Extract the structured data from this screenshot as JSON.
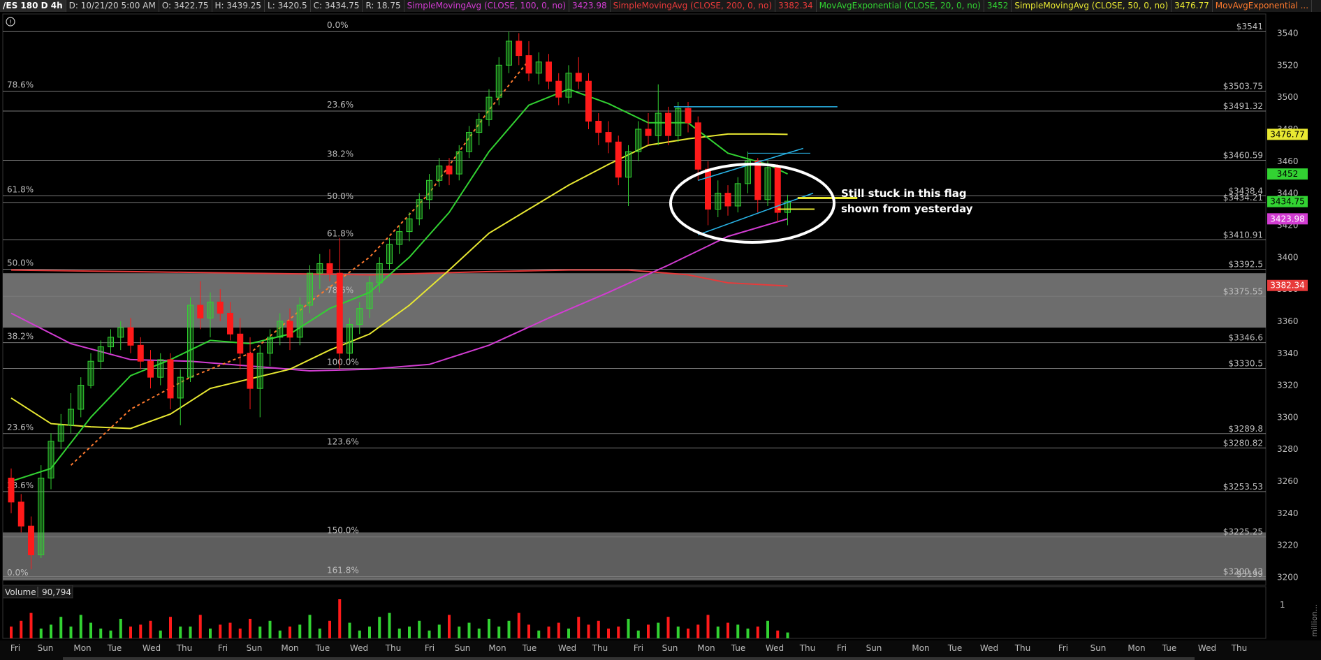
{
  "header": {
    "symbol": "/ES 180 D 4h",
    "date": "D: 10/21/20 5:00 AM",
    "open": "O: 3422.75",
    "high": "H: 3439.25",
    "low": "L: 3420.5",
    "close": "C: 3434.75",
    "range": "R: 18.75",
    "studies": [
      {
        "label": "SimpleMovingAvg (CLOSE, 100, 0, no)",
        "value": "3423.98",
        "color": "#d23cd2"
      },
      {
        "label": "SimpleMovingAvg (CLOSE, 200, 0, no)",
        "value": "3382.34",
        "color": "#e83a3a"
      },
      {
        "label": "MovAvgExponential (CLOSE, 20, 0, no)",
        "value": "3452",
        "color": "#32d232"
      },
      {
        "label": "SimpleMovingAvg (CLOSE, 50, 0, no)",
        "value": "3476.77",
        "color": "#e8e832"
      },
      {
        "label": "MovAvgExponential ...",
        "value": "",
        "color": "#ff7a2e"
      }
    ]
  },
  "annotation": {
    "line1": "Still stuck in this flag",
    "line2": "shown from yesterday"
  },
  "volume": {
    "label": "Volume",
    "value": "90,794",
    "scale_label": "1",
    "unit_label": "million..."
  },
  "chart_data": {
    "type": "candlestick",
    "symbol": "/ES",
    "timeframe": "4h",
    "ylim": [
      3195,
      3552
    ],
    "y_ticks": [
      3200,
      3220,
      3240,
      3260,
      3280,
      3300,
      3320,
      3340,
      3360,
      3380,
      3400,
      3420,
      3440,
      3460,
      3480,
      3500,
      3520,
      3540
    ],
    "x_labels": [
      "Fri",
      "Sun",
      "Mon",
      "Tue",
      "Wed",
      "Thu",
      "Fri",
      "Sun",
      "Mon",
      "Tue",
      "Wed",
      "Thu",
      "Fri",
      "Sun",
      "Mon",
      "Tue",
      "Wed",
      "Thu",
      "Fri",
      "Sun",
      "Mon",
      "Tue",
      "Wed",
      "Thu",
      "Fri",
      "Sun",
      "Mon",
      "Tue",
      "Wed",
      "Thu",
      "Fri",
      "Sun",
      "Mon",
      "Tue",
      "Wed",
      "Thu"
    ],
    "price_levels": [
      {
        "value": 3541,
        "label": "$3541"
      },
      {
        "value": 3503.75,
        "label": "$3503.75"
      },
      {
        "value": 3491.32,
        "label": "$3491.32"
      },
      {
        "value": 3460.59,
        "label": "$3460.59"
      },
      {
        "value": 3438.4,
        "label": "$3438.4"
      },
      {
        "value": 3434.21,
        "label": "$3434.21"
      },
      {
        "value": 3410.91,
        "label": "$3410.91"
      },
      {
        "value": 3392.5,
        "label": "$3392.5"
      },
      {
        "value": 3375.55,
        "label": "$3375.55"
      },
      {
        "value": 3346.6,
        "label": "$3346.6"
      },
      {
        "value": 3330.5,
        "label": "$3330.5"
      },
      {
        "value": 3289.8,
        "label": "$3289.8"
      },
      {
        "value": 3280.82,
        "label": "$3280.82"
      },
      {
        "value": 3253.53,
        "label": "$3253.53"
      },
      {
        "value": 3225.25,
        "label": "$3225.25"
      },
      {
        "value": 3200.43,
        "label": "$3200.43"
      },
      {
        "value": 3199,
        "label": "$3199"
      }
    ],
    "fib_set_left": [
      {
        "label": "78.6%",
        "value": 3503.75
      },
      {
        "label": "61.8%",
        "value": 3438.4
      },
      {
        "label": "50.0%",
        "value": 3392.5
      },
      {
        "label": "38.2%",
        "value": 3346.6
      },
      {
        "label": "23.6%",
        "value": 3289.8
      },
      {
        "label": "23.6%",
        "value": 3253.53
      },
      {
        "label": "0.0%",
        "value": 3199
      }
    ],
    "fib_set_mid": [
      {
        "label": "0.0%",
        "value": 3541
      },
      {
        "label": "23.6%",
        "value": 3491.32
      },
      {
        "label": "38.2%",
        "value": 3460.59
      },
      {
        "label": "50.0%",
        "value": 3434.21
      },
      {
        "label": "61.8%",
        "value": 3410.91
      },
      {
        "label": "78.6%",
        "value": 3375.55
      },
      {
        "label": "100.0%",
        "value": 3330.5
      },
      {
        "label": "123.6%",
        "value": 3280.82
      },
      {
        "label": "150.0%",
        "value": 3225.25
      },
      {
        "label": "161.8%",
        "value": 3200.43
      }
    ],
    "zones": [
      {
        "from": 3356,
        "to": 3390,
        "color": "#808080"
      },
      {
        "from": 3198,
        "to": 3228,
        "color": "#6e6e6e"
      }
    ],
    "price_tags": [
      {
        "value": 3476.77,
        "label": "3476.77",
        "color": "#e8e832"
      },
      {
        "value": 3452,
        "label": "3452",
        "color": "#32d232"
      },
      {
        "value": 3434.75,
        "label": "3434.75",
        "color": "#32d232"
      },
      {
        "value": 3423.98,
        "label": "3423.98",
        "color": "#d23cd2"
      },
      {
        "value": 3382.34,
        "label": "3382.34",
        "color": "#e83a3a"
      }
    ],
    "colors": {
      "up": "#32d232",
      "down": "#ff1a1a",
      "ema20": "#32d232",
      "sma50": "#e8e832",
      "sma100": "#d23cd2",
      "sma200": "#e83a3a",
      "ema_other": "#ff7a2e",
      "channel": "#29b5e8"
    },
    "candles": [
      {
        "i": 0,
        "o": 3262,
        "h": 3268,
        "l": 3240,
        "c": 3247
      },
      {
        "i": 1,
        "o": 3247,
        "h": 3252,
        "l": 3228,
        "c": 3232
      },
      {
        "i": 2,
        "o": 3232,
        "h": 3238,
        "l": 3205,
        "c": 3214
      },
      {
        "i": 3,
        "o": 3214,
        "h": 3270,
        "l": 3212,
        "c": 3262
      },
      {
        "i": 4,
        "o": 3262,
        "h": 3290,
        "l": 3255,
        "c": 3285
      },
      {
        "i": 5,
        "o": 3285,
        "h": 3302,
        "l": 3280,
        "c": 3295
      },
      {
        "i": 6,
        "o": 3295,
        "h": 3315,
        "l": 3290,
        "c": 3305
      },
      {
        "i": 7,
        "o": 3305,
        "h": 3325,
        "l": 3300,
        "c": 3320
      },
      {
        "i": 8,
        "o": 3320,
        "h": 3340,
        "l": 3318,
        "c": 3335
      },
      {
        "i": 9,
        "o": 3335,
        "h": 3348,
        "l": 3330,
        "c": 3344
      },
      {
        "i": 10,
        "o": 3344,
        "h": 3355,
        "l": 3340,
        "c": 3350
      },
      {
        "i": 11,
        "o": 3350,
        "h": 3360,
        "l": 3342,
        "c": 3356
      },
      {
        "i": 12,
        "o": 3356,
        "h": 3362,
        "l": 3340,
        "c": 3345
      },
      {
        "i": 13,
        "o": 3345,
        "h": 3350,
        "l": 3330,
        "c": 3335
      },
      {
        "i": 14,
        "o": 3335,
        "h": 3342,
        "l": 3318,
        "c": 3325
      },
      {
        "i": 15,
        "o": 3325,
        "h": 3340,
        "l": 3320,
        "c": 3336
      },
      {
        "i": 16,
        "o": 3336,
        "h": 3340,
        "l": 3305,
        "c": 3312
      },
      {
        "i": 17,
        "o": 3312,
        "h": 3330,
        "l": 3295,
        "c": 3325
      },
      {
        "i": 18,
        "o": 3325,
        "h": 3375,
        "l": 3322,
        "c": 3370
      },
      {
        "i": 19,
        "o": 3370,
        "h": 3385,
        "l": 3355,
        "c": 3362
      },
      {
        "i": 20,
        "o": 3362,
        "h": 3378,
        "l": 3350,
        "c": 3372
      },
      {
        "i": 21,
        "o": 3372,
        "h": 3380,
        "l": 3360,
        "c": 3365
      },
      {
        "i": 22,
        "o": 3365,
        "h": 3372,
        "l": 3348,
        "c": 3352
      },
      {
        "i": 23,
        "o": 3352,
        "h": 3362,
        "l": 3330,
        "c": 3340
      },
      {
        "i": 24,
        "o": 3340,
        "h": 3350,
        "l": 3305,
        "c": 3318
      },
      {
        "i": 25,
        "o": 3318,
        "h": 3345,
        "l": 3300,
        "c": 3340
      },
      {
        "i": 26,
        "o": 3340,
        "h": 3355,
        "l": 3332,
        "c": 3350
      },
      {
        "i": 27,
        "o": 3350,
        "h": 3365,
        "l": 3345,
        "c": 3360
      },
      {
        "i": 28,
        "o": 3360,
        "h": 3368,
        "l": 3342,
        "c": 3350
      },
      {
        "i": 29,
        "o": 3350,
        "h": 3375,
        "l": 3345,
        "c": 3370
      },
      {
        "i": 30,
        "o": 3370,
        "h": 3395,
        "l": 3365,
        "c": 3390
      },
      {
        "i": 31,
        "o": 3390,
        "h": 3402,
        "l": 3380,
        "c": 3396
      },
      {
        "i": 32,
        "o": 3396,
        "h": 3405,
        "l": 3385,
        "c": 3390
      },
      {
        "i": 33,
        "o": 3390,
        "h": 3412,
        "l": 3330,
        "c": 3340
      },
      {
        "i": 34,
        "o": 3340,
        "h": 3362,
        "l": 3336,
        "c": 3358
      },
      {
        "i": 35,
        "o": 3358,
        "h": 3372,
        "l": 3352,
        "c": 3368
      },
      {
        "i": 36,
        "o": 3368,
        "h": 3388,
        "l": 3362,
        "c": 3384
      },
      {
        "i": 37,
        "o": 3384,
        "h": 3400,
        "l": 3378,
        "c": 3396
      },
      {
        "i": 38,
        "o": 3396,
        "h": 3412,
        "l": 3392,
        "c": 3408
      },
      {
        "i": 39,
        "o": 3408,
        "h": 3420,
        "l": 3402,
        "c": 3416
      },
      {
        "i": 40,
        "o": 3416,
        "h": 3428,
        "l": 3410,
        "c": 3424
      },
      {
        "i": 41,
        "o": 3424,
        "h": 3440,
        "l": 3420,
        "c": 3436
      },
      {
        "i": 42,
        "o": 3436,
        "h": 3452,
        "l": 3430,
        "c": 3448
      },
      {
        "i": 43,
        "o": 3448,
        "h": 3462,
        "l": 3444,
        "c": 3457
      },
      {
        "i": 44,
        "o": 3457,
        "h": 3462,
        "l": 3445,
        "c": 3452
      },
      {
        "i": 45,
        "o": 3452,
        "h": 3470,
        "l": 3448,
        "c": 3466
      },
      {
        "i": 46,
        "o": 3466,
        "h": 3482,
        "l": 3462,
        "c": 3478
      },
      {
        "i": 47,
        "o": 3478,
        "h": 3490,
        "l": 3470,
        "c": 3486
      },
      {
        "i": 48,
        "o": 3486,
        "h": 3505,
        "l": 3482,
        "c": 3500
      },
      {
        "i": 49,
        "o": 3500,
        "h": 3525,
        "l": 3495,
        "c": 3520
      },
      {
        "i": 50,
        "o": 3520,
        "h": 3541,
        "l": 3515,
        "c": 3535
      },
      {
        "i": 51,
        "o": 3535,
        "h": 3540,
        "l": 3520,
        "c": 3526
      },
      {
        "i": 52,
        "o": 3526,
        "h": 3535,
        "l": 3510,
        "c": 3515
      },
      {
        "i": 53,
        "o": 3515,
        "h": 3528,
        "l": 3508,
        "c": 3522
      },
      {
        "i": 54,
        "o": 3522,
        "h": 3527,
        "l": 3505,
        "c": 3510
      },
      {
        "i": 55,
        "o": 3510,
        "h": 3515,
        "l": 3495,
        "c": 3500
      },
      {
        "i": 56,
        "o": 3500,
        "h": 3520,
        "l": 3496,
        "c": 3515
      },
      {
        "i": 57,
        "o": 3515,
        "h": 3525,
        "l": 3505,
        "c": 3510
      },
      {
        "i": 58,
        "o": 3510,
        "h": 3515,
        "l": 3480,
        "c": 3485
      },
      {
        "i": 59,
        "o": 3485,
        "h": 3490,
        "l": 3470,
        "c": 3478
      },
      {
        "i": 60,
        "o": 3478,
        "h": 3485,
        "l": 3465,
        "c": 3472
      },
      {
        "i": 61,
        "o": 3472,
        "h": 3476,
        "l": 3445,
        "c": 3450
      },
      {
        "i": 62,
        "o": 3450,
        "h": 3470,
        "l": 3432,
        "c": 3466
      },
      {
        "i": 63,
        "o": 3466,
        "h": 3485,
        "l": 3460,
        "c": 3480
      },
      {
        "i": 64,
        "o": 3480,
        "h": 3490,
        "l": 3470,
        "c": 3476
      },
      {
        "i": 65,
        "o": 3476,
        "h": 3508,
        "l": 3470,
        "c": 3490
      },
      {
        "i": 66,
        "o": 3490,
        "h": 3494,
        "l": 3470,
        "c": 3476
      },
      {
        "i": 67,
        "o": 3476,
        "h": 3497,
        "l": 3472,
        "c": 3493
      },
      {
        "i": 68,
        "o": 3493,
        "h": 3497,
        "l": 3478,
        "c": 3484
      },
      {
        "i": 69,
        "o": 3484,
        "h": 3488,
        "l": 3448,
        "c": 3455
      },
      {
        "i": 70,
        "o": 3455,
        "h": 3460,
        "l": 3420,
        "c": 3430
      },
      {
        "i": 71,
        "o": 3430,
        "h": 3448,
        "l": 3425,
        "c": 3440
      },
      {
        "i": 72,
        "o": 3440,
        "h": 3445,
        "l": 3426,
        "c": 3432
      },
      {
        "i": 73,
        "o": 3432,
        "h": 3450,
        "l": 3428,
        "c": 3446
      },
      {
        "i": 74,
        "o": 3446,
        "h": 3466,
        "l": 3440,
        "c": 3460
      },
      {
        "i": 75,
        "o": 3460,
        "h": 3462,
        "l": 3428,
        "c": 3436
      },
      {
        "i": 76,
        "o": 3436,
        "h": 3460,
        "l": 3432,
        "c": 3456
      },
      {
        "i": 77,
        "o": 3456,
        "h": 3458,
        "l": 3422,
        "c": 3428
      },
      {
        "i": 78,
        "o": 3428,
        "h": 3439,
        "l": 3420,
        "c": 3435
      }
    ],
    "sma100": [
      [
        0,
        3365
      ],
      [
        6,
        3346
      ],
      [
        12,
        3336
      ],
      [
        18,
        3335
      ],
      [
        24,
        3332
      ],
      [
        30,
        3329
      ],
      [
        36,
        3330
      ],
      [
        42,
        3333
      ],
      [
        48,
        3345
      ],
      [
        54,
        3362
      ],
      [
        60,
        3378
      ],
      [
        66,
        3395
      ],
      [
        72,
        3413
      ],
      [
        78,
        3424
      ]
    ],
    "sma200": [
      [
        0,
        3392
      ],
      [
        12,
        3391
      ],
      [
        24,
        3390
      ],
      [
        36,
        3389
      ],
      [
        48,
        3391
      ],
      [
        56,
        3392
      ],
      [
        62,
        3392
      ],
      [
        68,
        3389
      ],
      [
        72,
        3384
      ],
      [
        78,
        3382
      ]
    ],
    "ema20": [
      [
        0,
        3260
      ],
      [
        4,
        3268
      ],
      [
        8,
        3300
      ],
      [
        12,
        3326
      ],
      [
        16,
        3336
      ],
      [
        20,
        3348
      ],
      [
        24,
        3346
      ],
      [
        28,
        3352
      ],
      [
        32,
        3368
      ],
      [
        36,
        3378
      ],
      [
        40,
        3400
      ],
      [
        44,
        3428
      ],
      [
        48,
        3466
      ],
      [
        52,
        3495
      ],
      [
        56,
        3505
      ],
      [
        60,
        3496
      ],
      [
        64,
        3484
      ],
      [
        68,
        3484
      ],
      [
        72,
        3465
      ],
      [
        76,
        3458
      ],
      [
        78,
        3452
      ]
    ],
    "sma50": [
      [
        0,
        3312
      ],
      [
        4,
        3296
      ],
      [
        8,
        3294
      ],
      [
        12,
        3293
      ],
      [
        16,
        3302
      ],
      [
        20,
        3318
      ],
      [
        24,
        3324
      ],
      [
        28,
        3330
      ],
      [
        32,
        3342
      ],
      [
        36,
        3352
      ],
      [
        40,
        3370
      ],
      [
        44,
        3392
      ],
      [
        48,
        3415
      ],
      [
        52,
        3430
      ],
      [
        56,
        3445
      ],
      [
        60,
        3458
      ],
      [
        64,
        3470
      ],
      [
        68,
        3474
      ],
      [
        72,
        3477
      ],
      [
        76,
        3477
      ],
      [
        78,
        3476.77
      ]
    ],
    "ema_other": [
      [
        6,
        3270
      ],
      [
        12,
        3305
      ],
      [
        18,
        3325
      ],
      [
        24,
        3340
      ],
      [
        30,
        3372
      ],
      [
        36,
        3400
      ],
      [
        42,
        3440
      ],
      [
        48,
        3492
      ],
      [
        52,
        3523
      ]
    ],
    "volume_bars": [
      0.3,
      0.45,
      0.65,
      0.25,
      0.35,
      0.55,
      0.3,
      0.6,
      0.4,
      0.25,
      0.2,
      0.5,
      0.3,
      0.35,
      0.45,
      0.2,
      0.55,
      0.3,
      0.3,
      0.6,
      0.25,
      0.35,
      0.4,
      0.25,
      0.5,
      0.3,
      0.45,
      0.2,
      0.3,
      0.35,
      0.6,
      0.25,
      0.45,
      1.0,
      0.4,
      0.2,
      0.3,
      0.55,
      0.65,
      0.25,
      0.3,
      0.45,
      0.2,
      0.35,
      0.6,
      0.3,
      0.4,
      0.25,
      0.5,
      0.3,
      0.45,
      0.65,
      0.35,
      0.2,
      0.3,
      0.4,
      0.25,
      0.55,
      0.35,
      0.45,
      0.25,
      0.3,
      0.5,
      0.2,
      0.35,
      0.4,
      0.55,
      0.3,
      0.25,
      0.35,
      0.6,
      0.3,
      0.4,
      0.35,
      0.25,
      0.3,
      0.45,
      0.2,
      0.15
    ]
  }
}
